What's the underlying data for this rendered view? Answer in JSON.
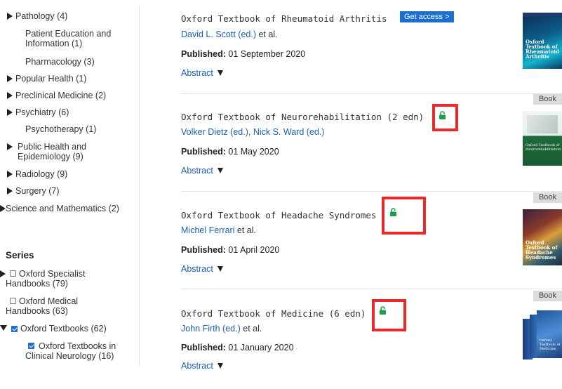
{
  "sidebar": {
    "subjects": [
      {
        "label": "Pathology (4)"
      },
      {
        "label": "Patient Education and Information (1)"
      },
      {
        "label": "Pharmacology (3)"
      },
      {
        "label": "Popular Health (1)"
      },
      {
        "label": "Preclinical Medicine (2)"
      },
      {
        "label": "Psychiatry (6)"
      },
      {
        "label": "Psychotherapy (1)"
      },
      {
        "label": "Public Health and Epidemiology (9)"
      },
      {
        "label": "Radiology (9)"
      },
      {
        "label": "Surgery (7)"
      },
      {
        "label": "Science and Mathematics (2)"
      }
    ],
    "series_heading": "Series",
    "series": [
      {
        "label": "Oxford Specialist Handbooks (79)",
        "checked": false
      },
      {
        "label": "Oxford Medical Handbooks (63)",
        "checked": false
      },
      {
        "label": "Oxford Textbooks (62)",
        "checked": true
      },
      {
        "label": "Oxford Textbooks in Clinical Neurology (16)",
        "checked": true
      }
    ]
  },
  "results": [
    {
      "title": "Oxford Textbook of Rheumatoid Arthritis",
      "access_button": "Get access >",
      "authors": "David L. Scott (ed.)",
      "etal": " et al.",
      "published_label": "Published:",
      "published_date": "01 September 2020",
      "abstract_label": "Abstract",
      "cover_title": "Oxford Textbook of Rheumatoid Arthritis"
    },
    {
      "title": "Oxford Textbook of Neurorehabilitation (2 edn)",
      "badge": "Book",
      "authors": "Volker Dietz (ed.), Nick S. Ward (ed.)",
      "etal": "",
      "published_label": "Published:",
      "published_date": "01 May 2020",
      "abstract_label": "Abstract",
      "cover_title": "Oxford Textbook of Neurorehabilitation"
    },
    {
      "title": "Oxford Textbook of Headache Syndromes",
      "badge": "Book",
      "authors": "Michel Ferrari",
      "etal": " et al.",
      "published_label": "Published:",
      "published_date": "01 April 2020",
      "abstract_label": "Abstract",
      "cover_title": "Oxford Textbook of Headache Syndromes"
    },
    {
      "title": "Oxford Textbook of Medicine (6 edn)",
      "badge": "Book",
      "authors": "John Firth (ed.)",
      "etal": " et al.",
      "published_label": "Published:",
      "published_date": "01 January 2020",
      "abstract_label": "Abstract",
      "cover_title": "Oxford Textbook of Medicine"
    }
  ],
  "colors": {
    "link": "#1a5fb4",
    "access_button": "#1a6fd0",
    "lock_icon": "#1e9e4a",
    "highlight_box": "#ea2a2a",
    "badge": "#dcdcdc"
  },
  "icons": {
    "open_access": "lock-open-icon",
    "expand": "triangle-right-icon",
    "collapse": "triangle-down-icon"
  }
}
